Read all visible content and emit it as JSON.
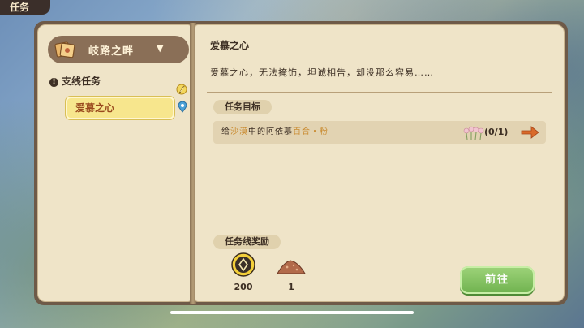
{
  "header": {
    "tab_label": "任务"
  },
  "sidebar": {
    "region_label": "岐路之畔",
    "category_label": "支线任务",
    "selected_quest": "爱慕之心"
  },
  "quest": {
    "title": "爱慕之心",
    "description": "爱慕之心，无法掩饰，坦诚相告，却没那么容易……",
    "objectives_label": "任务目标",
    "objective": {
      "text_prefix": "给",
      "location": "沙漠",
      "text_mid": "中的阿依慕",
      "item": "百合・粉",
      "progress": "(0/1)"
    },
    "rewards_label": "任务线奖励",
    "rewards": [
      {
        "icon": "coin-icon",
        "count": "200"
      },
      {
        "icon": "ore-pile-icon",
        "count": "1"
      }
    ],
    "go_button": "前往"
  }
}
